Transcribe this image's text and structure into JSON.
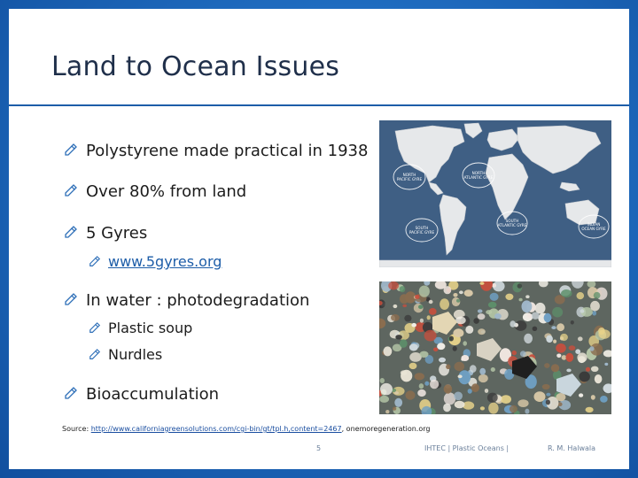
{
  "slide": {
    "title": "Land to Ocean Issues",
    "bullets": [
      {
        "text": "Polystyrene made practical in 1938",
        "level": 1
      },
      {
        "text": "Over 80% from land",
        "level": 1
      },
      {
        "text": "5 Gyres",
        "level": 1
      },
      {
        "text": "www.5gyres.org",
        "level": 2,
        "link": true
      },
      {
        "text": "In water : photodegradation",
        "level": 1
      },
      {
        "text": "Plastic soup",
        "level": 2
      },
      {
        "text": "Nurdles",
        "level": 2
      },
      {
        "text": "Bioaccumulation",
        "level": 1
      }
    ],
    "bullet_icon": "pencil-arrow-icon",
    "map_labels": {
      "north_pacific": [
        "NORTH",
        "PACIFIC GYRE"
      ],
      "north_atlantic": [
        "NORTH",
        "ATLANTIC GYRE"
      ],
      "south_atlantic": [
        "SOUTH",
        "ATLANTIC GYRE"
      ],
      "south_pacific": [
        "SOUTH",
        "PACIFIC GYRE"
      ],
      "indian_ocean": [
        "INDIAN",
        "OCEAN GYRE"
      ]
    },
    "source": {
      "prefix": "Source: ",
      "url": "http://www.californiagreensolutions.com/cgi-bin/gt/tpl.h,content=2467",
      "suffix": ", onemoregeneration.org"
    },
    "footer": {
      "page_number": "5",
      "center_text": "IHTEC   | Plastic Oceans |",
      "author": "R. M. Halwala"
    }
  },
  "colors": {
    "background_blue": "#1f6cc0",
    "title_rule": "#1d5da8",
    "ocean": "#3f5f84",
    "link": "#1d5da8"
  }
}
